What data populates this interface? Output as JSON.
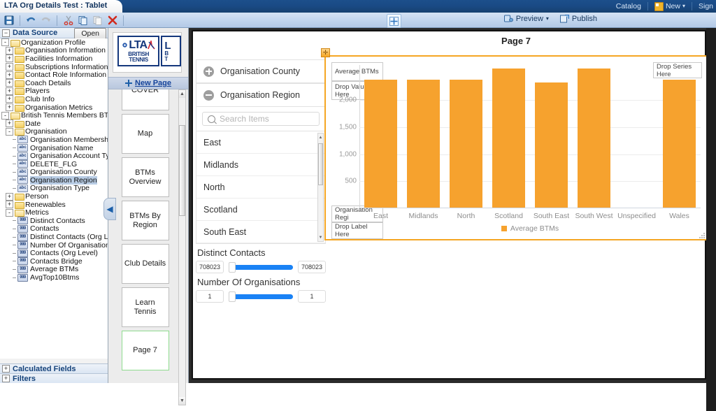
{
  "titlebar": {
    "document_tab": "LTA Org Details Test : Tablet",
    "catalog": "Catalog",
    "new": "New",
    "signin": "Sign"
  },
  "toolbar": {
    "icons": [
      "save-icon",
      "undo-icon",
      "redo-icon",
      "cut-icon",
      "copy-icon",
      "paste-icon",
      "delete-icon"
    ],
    "center_icon": "add-panel-icon",
    "preview": "Preview",
    "publish": "Publish"
  },
  "left_panel": {
    "header": "Data Source",
    "open_button": "Open",
    "tree": [
      {
        "label": "Organization Profile",
        "indent": 0,
        "toggle": "-",
        "icon": "folder-open",
        "sel": false
      },
      {
        "label": "Organisation Information",
        "indent": 1,
        "toggle": "+",
        "icon": "folder",
        "sel": false
      },
      {
        "label": "Facilities Information",
        "indent": 1,
        "toggle": "+",
        "icon": "folder",
        "sel": false
      },
      {
        "label": "Subscriptions Information",
        "indent": 1,
        "toggle": "+",
        "icon": "folder",
        "sel": false
      },
      {
        "label": "Contact Role Information",
        "indent": 1,
        "toggle": "+",
        "icon": "folder",
        "sel": false
      },
      {
        "label": "Coach Details",
        "indent": 1,
        "toggle": "+",
        "icon": "folder",
        "sel": false
      },
      {
        "label": "Players",
        "indent": 1,
        "toggle": "+",
        "icon": "folder",
        "sel": false
      },
      {
        "label": "Club Info",
        "indent": 1,
        "toggle": "+",
        "icon": "folder",
        "sel": false
      },
      {
        "label": "Organisation Metrics",
        "indent": 1,
        "toggle": "+",
        "icon": "folder",
        "sel": false
      },
      {
        "label": "British Tennis Members BTMSH",
        "indent": 0,
        "toggle": "-",
        "icon": "folder-open",
        "sel": false
      },
      {
        "label": "Date",
        "indent": 1,
        "toggle": "+",
        "icon": "folder",
        "sel": false
      },
      {
        "label": "Organisation",
        "indent": 1,
        "toggle": "-",
        "icon": "folder-open",
        "sel": false
      },
      {
        "label": "Organisation Membership Nu",
        "indent": 2,
        "toggle": "",
        "icon": "abc",
        "sel": false
      },
      {
        "label": "Organisation Name",
        "indent": 2,
        "toggle": "",
        "icon": "abc",
        "sel": false
      },
      {
        "label": "Organisation Account Type",
        "indent": 2,
        "toggle": "",
        "icon": "abc",
        "sel": false
      },
      {
        "label": "DELETE_FLG",
        "indent": 2,
        "toggle": "",
        "icon": "abc",
        "sel": false
      },
      {
        "label": "Organisation County",
        "indent": 2,
        "toggle": "",
        "icon": "abc",
        "sel": false
      },
      {
        "label": "Organisation Region",
        "indent": 2,
        "toggle": "",
        "icon": "abc",
        "sel": true
      },
      {
        "label": "Organisation Type",
        "indent": 2,
        "toggle": "",
        "icon": "abc",
        "sel": false
      },
      {
        "label": "Person",
        "indent": 1,
        "toggle": "+",
        "icon": "folder",
        "sel": false
      },
      {
        "label": "Renewables",
        "indent": 1,
        "toggle": "+",
        "icon": "folder",
        "sel": false
      },
      {
        "label": "Metrics",
        "indent": 1,
        "toggle": "-",
        "icon": "folder-open",
        "sel": false
      },
      {
        "label": "Distinct Contacts",
        "indent": 2,
        "toggle": "",
        "icon": "num",
        "sel": false
      },
      {
        "label": "Contacts",
        "indent": 2,
        "toggle": "",
        "icon": "num",
        "sel": false
      },
      {
        "label": "Distinct Contacts (Org Level)",
        "indent": 2,
        "toggle": "",
        "icon": "num",
        "sel": false
      },
      {
        "label": "Number Of Organisations",
        "indent": 2,
        "toggle": "",
        "icon": "num",
        "sel": false
      },
      {
        "label": "Contacts (Org Level)",
        "indent": 2,
        "toggle": "",
        "icon": "num",
        "sel": false
      },
      {
        "label": "Contacts Bridge",
        "indent": 2,
        "toggle": "",
        "icon": "num",
        "sel": false
      },
      {
        "label": "Average BTMs",
        "indent": 2,
        "toggle": "",
        "icon": "num",
        "sel": false
      },
      {
        "label": "AvgTop10Btms",
        "indent": 2,
        "toggle": "",
        "icon": "num",
        "sel": false
      }
    ],
    "bottom_sections": [
      "Calculated Fields",
      "Filters"
    ]
  },
  "pages_panel": {
    "logo": {
      "line1": "LTA",
      "line2": "BRITISH",
      "line3": "TENNIS"
    },
    "new_page": "New Page",
    "thumbnails": [
      {
        "label": "COVER",
        "active": false
      },
      {
        "label": "Map",
        "active": false
      },
      {
        "label": "BTMs Overview",
        "active": false
      },
      {
        "label": "BTMs By Region",
        "active": false
      },
      {
        "label": "Club Details",
        "active": false
      },
      {
        "label": "Learn Tennis",
        "active": false
      },
      {
        "label": "Page 7",
        "active": true
      }
    ],
    "collapse_icon": "chevron-left-icon"
  },
  "prompts": {
    "items": [
      {
        "label": "Organisation County",
        "state": "collapsed"
      },
      {
        "label": "Organisation Region",
        "state": "expanded"
      }
    ],
    "search_placeholder": "Search Items",
    "region_values": [
      "East",
      "Midlands",
      "North",
      "Scotland",
      "South East"
    ],
    "sliders": [
      {
        "title": "Distinct Contacts",
        "min": "708023",
        "max": "708023"
      },
      {
        "title": "Number Of Organisations",
        "min": "1",
        "max": "1"
      }
    ]
  },
  "chart_panel": {
    "page_title": "Page 7",
    "drop_value_field": "Average BTMs",
    "drop_value_placeholder": "Drop Value Here",
    "drop_series_placeholder": "Drop Series Here",
    "drop_label_field": "Organisation Regi",
    "drop_label_placeholder": "Drop Label Here",
    "accent_color": "#f5a623",
    "bar_color": "#f6a22e"
  },
  "chart_data": {
    "type": "bar",
    "title": "Page 7",
    "xlabel": "Organisation Region",
    "ylabel": "Average BTMs",
    "categories": [
      "East",
      "Midlands",
      "North",
      "Scotland",
      "South East",
      "South West",
      "Unspecified",
      "Wales"
    ],
    "series": [
      {
        "name": "Average BTMs",
        "values": [
          2370,
          2370,
          2370,
          2570,
          2315,
          2570,
          0,
          2370
        ]
      }
    ],
    "ytick_labels": [
      "500",
      "1,000",
      "1,500",
      "2,000"
    ],
    "ytick_values": [
      500,
      1000,
      1500,
      2000
    ],
    "ylim": [
      0,
      2650
    ],
    "grid": true,
    "legend": [
      "Average BTMs"
    ],
    "legend_position": "bottom"
  }
}
